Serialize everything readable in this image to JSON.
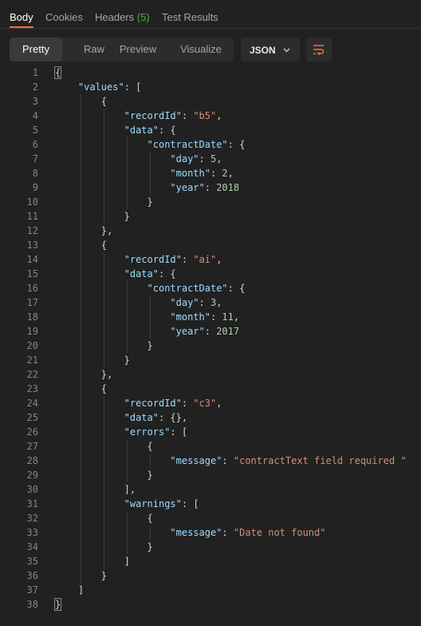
{
  "tabs": [
    {
      "label": "Body",
      "active": true
    },
    {
      "label": "Cookies"
    },
    {
      "label": "Headers",
      "count": "(5)"
    },
    {
      "label": "Test Results"
    }
  ],
  "views": [
    "Pretty",
    "Raw",
    "Preview",
    "Visualize"
  ],
  "active_view": "Pretty",
  "format": "JSON",
  "colors": {
    "key": "#9cdcfe",
    "string": "#ce9178",
    "number": "#b5cea8",
    "accent": "#ff6c37",
    "count": "#4caf50"
  },
  "code_lines": [
    {
      "n": "1",
      "i": 0,
      "t": [
        [
          "p",
          "{"
        ]
      ]
    },
    {
      "n": "2",
      "i": 1,
      "t": [
        [
          "k",
          "\"values\""
        ],
        [
          "p",
          ": ["
        ]
      ]
    },
    {
      "n": "3",
      "i": 2,
      "t": [
        [
          "p",
          "{"
        ]
      ]
    },
    {
      "n": "4",
      "i": 3,
      "t": [
        [
          "k",
          "\"recordId\""
        ],
        [
          "p",
          ": "
        ],
        [
          "s",
          "\"b5\""
        ],
        [
          "p",
          ","
        ]
      ]
    },
    {
      "n": "5",
      "i": 3,
      "t": [
        [
          "k",
          "\"data\""
        ],
        [
          "p",
          ": {"
        ]
      ]
    },
    {
      "n": "6",
      "i": 4,
      "t": [
        [
          "k",
          "\"contractDate\""
        ],
        [
          "p",
          ": {"
        ]
      ]
    },
    {
      "n": "7",
      "i": 5,
      "t": [
        [
          "k",
          "\"day\""
        ],
        [
          "p",
          ": "
        ],
        [
          "n",
          "5"
        ],
        [
          "p",
          ","
        ]
      ]
    },
    {
      "n": "8",
      "i": 5,
      "t": [
        [
          "k",
          "\"month\""
        ],
        [
          "p",
          ": "
        ],
        [
          "n",
          "2"
        ],
        [
          "p",
          ","
        ]
      ]
    },
    {
      "n": "9",
      "i": 5,
      "t": [
        [
          "k",
          "\"year\""
        ],
        [
          "p",
          ": "
        ],
        [
          "n",
          "2018"
        ]
      ]
    },
    {
      "n": "10",
      "i": 4,
      "t": [
        [
          "p",
          "}"
        ]
      ]
    },
    {
      "n": "11",
      "i": 3,
      "t": [
        [
          "p",
          "}"
        ]
      ]
    },
    {
      "n": "12",
      "i": 2,
      "t": [
        [
          "p",
          "},"
        ]
      ]
    },
    {
      "n": "13",
      "i": 2,
      "t": [
        [
          "p",
          "{"
        ]
      ]
    },
    {
      "n": "14",
      "i": 3,
      "t": [
        [
          "k",
          "\"recordId\""
        ],
        [
          "p",
          ": "
        ],
        [
          "s",
          "\"ai\""
        ],
        [
          "p",
          ","
        ]
      ]
    },
    {
      "n": "15",
      "i": 3,
      "t": [
        [
          "k",
          "\"data\""
        ],
        [
          "p",
          ": {"
        ]
      ]
    },
    {
      "n": "16",
      "i": 4,
      "t": [
        [
          "k",
          "\"contractDate\""
        ],
        [
          "p",
          ": {"
        ]
      ]
    },
    {
      "n": "17",
      "i": 5,
      "t": [
        [
          "k",
          "\"day\""
        ],
        [
          "p",
          ": "
        ],
        [
          "n",
          "3"
        ],
        [
          "p",
          ","
        ]
      ]
    },
    {
      "n": "18",
      "i": 5,
      "t": [
        [
          "k",
          "\"month\""
        ],
        [
          "p",
          ": "
        ],
        [
          "n",
          "11"
        ],
        [
          "p",
          ","
        ]
      ]
    },
    {
      "n": "19",
      "i": 5,
      "t": [
        [
          "k",
          "\"year\""
        ],
        [
          "p",
          ": "
        ],
        [
          "n",
          "2017"
        ]
      ]
    },
    {
      "n": "20",
      "i": 4,
      "t": [
        [
          "p",
          "}"
        ]
      ]
    },
    {
      "n": "21",
      "i": 3,
      "t": [
        [
          "p",
          "}"
        ]
      ]
    },
    {
      "n": "22",
      "i": 2,
      "t": [
        [
          "p",
          "},"
        ]
      ]
    },
    {
      "n": "23",
      "i": 2,
      "t": [
        [
          "p",
          "{"
        ]
      ]
    },
    {
      "n": "24",
      "i": 3,
      "t": [
        [
          "k",
          "\"recordId\""
        ],
        [
          "p",
          ": "
        ],
        [
          "s",
          "\"c3\""
        ],
        [
          "p",
          ","
        ]
      ]
    },
    {
      "n": "25",
      "i": 3,
      "t": [
        [
          "k",
          "\"data\""
        ],
        [
          "p",
          ": {},"
        ]
      ]
    },
    {
      "n": "26",
      "i": 3,
      "t": [
        [
          "k",
          "\"errors\""
        ],
        [
          "p",
          ": ["
        ]
      ]
    },
    {
      "n": "27",
      "i": 4,
      "t": [
        [
          "p",
          "{"
        ]
      ]
    },
    {
      "n": "28",
      "i": 5,
      "t": [
        [
          "k",
          "\"message\""
        ],
        [
          "p",
          ": "
        ],
        [
          "s",
          "\"contractText field required \""
        ]
      ]
    },
    {
      "n": "29",
      "i": 4,
      "t": [
        [
          "p",
          "}"
        ]
      ]
    },
    {
      "n": "30",
      "i": 3,
      "t": [
        [
          "p",
          "],"
        ]
      ]
    },
    {
      "n": "31",
      "i": 3,
      "t": [
        [
          "k",
          "\"warnings\""
        ],
        [
          "p",
          ": ["
        ]
      ]
    },
    {
      "n": "32",
      "i": 4,
      "t": [
        [
          "p",
          "{"
        ]
      ]
    },
    {
      "n": "33",
      "i": 5,
      "t": [
        [
          "k",
          "\"message\""
        ],
        [
          "p",
          ": "
        ],
        [
          "s",
          "\"Date not found\""
        ]
      ]
    },
    {
      "n": "34",
      "i": 4,
      "t": [
        [
          "p",
          "}"
        ]
      ]
    },
    {
      "n": "35",
      "i": 3,
      "t": [
        [
          "p",
          "]"
        ]
      ]
    },
    {
      "n": "36",
      "i": 2,
      "t": [
        [
          "p",
          "}"
        ]
      ]
    },
    {
      "n": "37",
      "i": 1,
      "t": [
        [
          "p",
          "]"
        ]
      ]
    },
    {
      "n": "38",
      "i": 0,
      "t": [
        [
          "p",
          "}"
        ]
      ]
    }
  ]
}
